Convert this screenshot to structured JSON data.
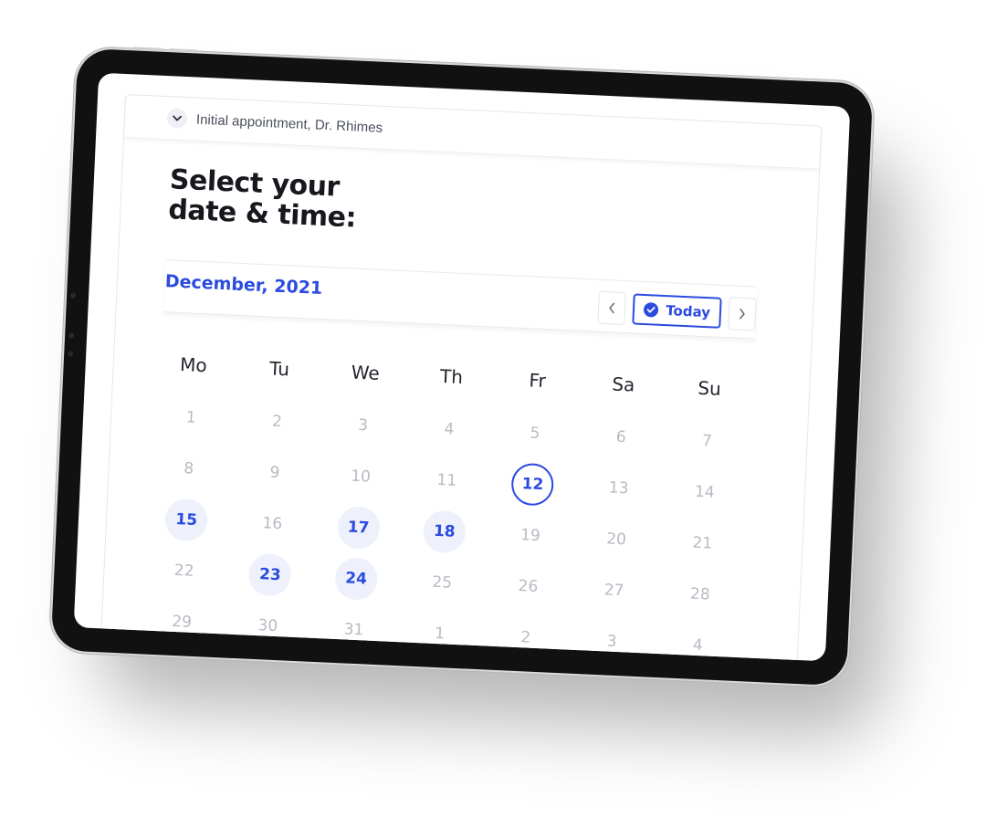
{
  "appointment": {
    "label": "Initial appointment, Dr. Rhimes",
    "toggle_icon": "chevron-down-icon"
  },
  "heading": {
    "line1": "Select your",
    "line2": "date & time:"
  },
  "calendar": {
    "month_label": "December, 2021",
    "today_label": "Today",
    "prev_icon": "chevron-left-icon",
    "next_icon": "chevron-right-icon",
    "today_icon": "check-circle-icon",
    "weekdays": [
      "Mo",
      "Tu",
      "We",
      "Th",
      "Fr",
      "Sa",
      "Su"
    ],
    "weeks": [
      [
        {
          "d": "1",
          "s": "disabled"
        },
        {
          "d": "2",
          "s": "disabled"
        },
        {
          "d": "3",
          "s": "disabled"
        },
        {
          "d": "4",
          "s": "disabled"
        },
        {
          "d": "5",
          "s": "disabled"
        },
        {
          "d": "6",
          "s": "disabled"
        },
        {
          "d": "7",
          "s": "disabled"
        }
      ],
      [
        {
          "d": "8",
          "s": "disabled"
        },
        {
          "d": "9",
          "s": "disabled"
        },
        {
          "d": "10",
          "s": "disabled"
        },
        {
          "d": "11",
          "s": "disabled"
        },
        {
          "d": "12",
          "s": "selected"
        },
        {
          "d": "13",
          "s": "disabled"
        },
        {
          "d": "14",
          "s": "disabled"
        }
      ],
      [
        {
          "d": "15",
          "s": "available"
        },
        {
          "d": "16",
          "s": "disabled"
        },
        {
          "d": "17",
          "s": "available"
        },
        {
          "d": "18",
          "s": "available"
        },
        {
          "d": "19",
          "s": "disabled"
        },
        {
          "d": "20",
          "s": "disabled"
        },
        {
          "d": "21",
          "s": "disabled"
        }
      ],
      [
        {
          "d": "22",
          "s": "disabled"
        },
        {
          "d": "23",
          "s": "available"
        },
        {
          "d": "24",
          "s": "available"
        },
        {
          "d": "25",
          "s": "disabled"
        },
        {
          "d": "26",
          "s": "disabled"
        },
        {
          "d": "27",
          "s": "disabled"
        },
        {
          "d": "28",
          "s": "disabled"
        }
      ],
      [
        {
          "d": "29",
          "s": "disabled"
        },
        {
          "d": "30",
          "s": "disabled"
        },
        {
          "d": "31",
          "s": "disabled"
        },
        {
          "d": "1",
          "s": "disabled"
        },
        {
          "d": "2",
          "s": "disabled"
        },
        {
          "d": "3",
          "s": "disabled"
        },
        {
          "d": "4",
          "s": "disabled"
        }
      ]
    ]
  },
  "colors": {
    "accent": "#2b4be0",
    "available_bg": "#eef0fb",
    "disabled_text": "#b8bbc3",
    "device_frame": "#111111"
  }
}
